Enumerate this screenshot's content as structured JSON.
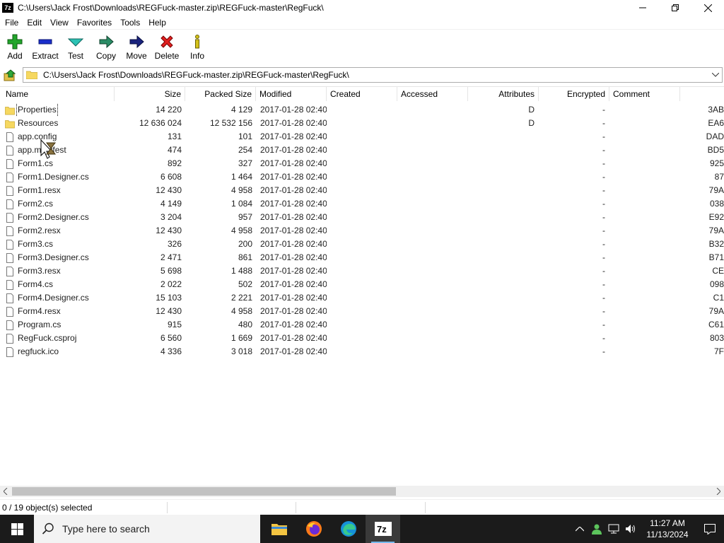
{
  "window": {
    "icon_text": "7z",
    "title": "C:\\Users\\Jack Frost\\Downloads\\REGFuck-master.zip\\REGFuck-master\\RegFuck\\"
  },
  "menu": [
    "File",
    "Edit",
    "View",
    "Favorites",
    "Tools",
    "Help"
  ],
  "toolbar": {
    "add": "Add",
    "extract": "Extract",
    "test": "Test",
    "copy": "Copy",
    "move": "Move",
    "delete": "Delete",
    "info": "Info"
  },
  "address": {
    "path": "C:\\Users\\Jack Frost\\Downloads\\REGFuck-master.zip\\REGFuck-master\\RegFuck\\"
  },
  "columns": {
    "name": "Name",
    "size": "Size",
    "packed": "Packed Size",
    "modified": "Modified",
    "created": "Created",
    "accessed": "Accessed",
    "attributes": "Attributes",
    "encrypted": "Encrypted",
    "comment": "Comment"
  },
  "files": [
    {
      "name": "Properties",
      "type": "folder",
      "size": "14 220",
      "packed": "4 129",
      "modified": "2017-01-28 02:40",
      "attributes": "D",
      "encrypted": "-",
      "crc": "3AB"
    },
    {
      "name": "Resources",
      "type": "folder",
      "size": "12 636 024",
      "packed": "12 532 156",
      "modified": "2017-01-28 02:40",
      "attributes": "D",
      "encrypted": "-",
      "crc": "EA6"
    },
    {
      "name": "app.config",
      "type": "file",
      "size": "131",
      "packed": "101",
      "modified": "2017-01-28 02:40",
      "attributes": "",
      "encrypted": "-",
      "crc": "DAD"
    },
    {
      "name": "app.manifest",
      "type": "file",
      "size": "474",
      "packed": "254",
      "modified": "2017-01-28 02:40",
      "attributes": "",
      "encrypted": "-",
      "crc": "BD5"
    },
    {
      "name": "Form1.cs",
      "type": "file",
      "size": "892",
      "packed": "327",
      "modified": "2017-01-28 02:40",
      "attributes": "",
      "encrypted": "-",
      "crc": "925"
    },
    {
      "name": "Form1.Designer.cs",
      "type": "file",
      "size": "6 608",
      "packed": "1 464",
      "modified": "2017-01-28 02:40",
      "attributes": "",
      "encrypted": "-",
      "crc": "87"
    },
    {
      "name": "Form1.resx",
      "type": "file",
      "size": "12 430",
      "packed": "4 958",
      "modified": "2017-01-28 02:40",
      "attributes": "",
      "encrypted": "-",
      "crc": "79A"
    },
    {
      "name": "Form2.cs",
      "type": "file",
      "size": "4 149",
      "packed": "1 084",
      "modified": "2017-01-28 02:40",
      "attributes": "",
      "encrypted": "-",
      "crc": "038"
    },
    {
      "name": "Form2.Designer.cs",
      "type": "file",
      "size": "3 204",
      "packed": "957",
      "modified": "2017-01-28 02:40",
      "attributes": "",
      "encrypted": "-",
      "crc": "E92"
    },
    {
      "name": "Form2.resx",
      "type": "file",
      "size": "12 430",
      "packed": "4 958",
      "modified": "2017-01-28 02:40",
      "attributes": "",
      "encrypted": "-",
      "crc": "79A"
    },
    {
      "name": "Form3.cs",
      "type": "file",
      "size": "326",
      "packed": "200",
      "modified": "2017-01-28 02:40",
      "attributes": "",
      "encrypted": "-",
      "crc": "B32"
    },
    {
      "name": "Form3.Designer.cs",
      "type": "file",
      "size": "2 471",
      "packed": "861",
      "modified": "2017-01-28 02:40",
      "attributes": "",
      "encrypted": "-",
      "crc": "B71"
    },
    {
      "name": "Form3.resx",
      "type": "file",
      "size": "5 698",
      "packed": "1 488",
      "modified": "2017-01-28 02:40",
      "attributes": "",
      "encrypted": "-",
      "crc": "CE"
    },
    {
      "name": "Form4.cs",
      "type": "file",
      "size": "2 022",
      "packed": "502",
      "modified": "2017-01-28 02:40",
      "attributes": "",
      "encrypted": "-",
      "crc": "098"
    },
    {
      "name": "Form4.Designer.cs",
      "type": "file",
      "size": "15 103",
      "packed": "2 221",
      "modified": "2017-01-28 02:40",
      "attributes": "",
      "encrypted": "-",
      "crc": "C1"
    },
    {
      "name": "Form4.resx",
      "type": "file",
      "size": "12 430",
      "packed": "4 958",
      "modified": "2017-01-28 02:40",
      "attributes": "",
      "encrypted": "-",
      "crc": "79A"
    },
    {
      "name": "Program.cs",
      "type": "file",
      "size": "915",
      "packed": "480",
      "modified": "2017-01-28 02:40",
      "attributes": "",
      "encrypted": "-",
      "crc": "C61"
    },
    {
      "name": "RegFuck.csproj",
      "type": "file",
      "size": "6 560",
      "packed": "1 669",
      "modified": "2017-01-28 02:40",
      "attributes": "",
      "encrypted": "-",
      "crc": "803"
    },
    {
      "name": "regfuck.ico",
      "type": "file",
      "size": "4 336",
      "packed": "3 018",
      "modified": "2017-01-28 02:40",
      "attributes": "",
      "encrypted": "-",
      "crc": "7F"
    }
  ],
  "status": {
    "selection": "0 / 19 object(s) selected"
  },
  "taskbar": {
    "search_placeholder": "Type here to search",
    "time": "11:27 AM",
    "date": "11/13/2024",
    "apps": [
      "file-explorer",
      "firefox",
      "edge",
      "7-zip"
    ]
  },
  "colors": {
    "folder": "#f6d860",
    "taskbar_bg": "#1b1b1b",
    "add_green": "#22a52b",
    "extract_blue": "#1a2ecc",
    "delete_red": "#e02020"
  }
}
